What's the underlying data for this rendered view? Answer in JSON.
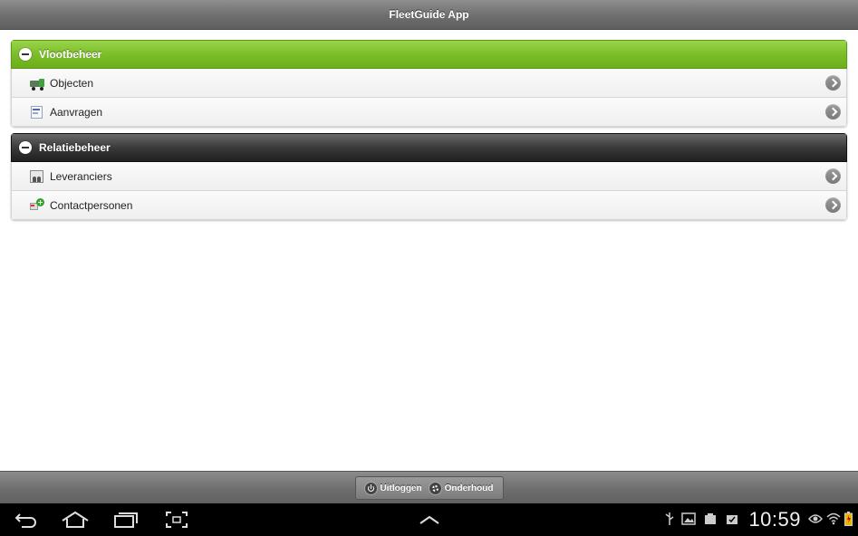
{
  "header": {
    "title": "FleetGuide App"
  },
  "groups": [
    {
      "title": "Vlootbeheer",
      "items": [
        {
          "label": "Objecten",
          "icon": "truck-icon"
        },
        {
          "label": "Aanvragen",
          "icon": "document-icon"
        }
      ]
    },
    {
      "title": "Relatiebeheer",
      "items": [
        {
          "label": "Leveranciers",
          "icon": "suppliers-icon"
        },
        {
          "label": "Contactpersonen",
          "icon": "add-contact-icon"
        }
      ]
    }
  ],
  "footer": {
    "logout_label": "Uitloggen",
    "maintenance_label": "Onderhoud"
  },
  "statusbar": {
    "time": "10:59"
  },
  "colors": {
    "group_vloot": "#7cbd2a",
    "group_relatie": "#2a2a2a"
  }
}
